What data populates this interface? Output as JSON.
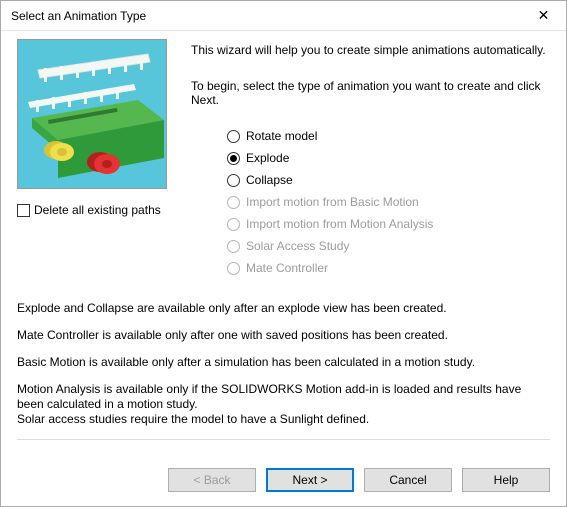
{
  "title": "Select an Animation Type",
  "intro1": "This wizard will help you to create simple animations automatically.",
  "intro2": "To begin, select the type of animation you want to create and click Next.",
  "delete_paths_label": "Delete all existing paths",
  "delete_paths_checked": false,
  "options": [
    {
      "label": "Rotate model",
      "enabled": true,
      "selected": false
    },
    {
      "label": "Explode",
      "enabled": true,
      "selected": true
    },
    {
      "label": "Collapse",
      "enabled": true,
      "selected": false
    },
    {
      "label": "Import motion from Basic Motion",
      "enabled": false,
      "selected": false
    },
    {
      "label": "Import motion from Motion Analysis",
      "enabled": false,
      "selected": false
    },
    {
      "label": "Solar Access Study",
      "enabled": false,
      "selected": false
    },
    {
      "label": "Mate Controller",
      "enabled": false,
      "selected": false
    }
  ],
  "notes": {
    "n1": "Explode and Collapse are available only after an explode view has been created.",
    "n2": "Mate Controller is available only after one with saved positions has been created.",
    "n3": "Basic Motion is available only after a simulation has been calculated in a motion study.",
    "n4": "Motion Analysis is available only if the SOLIDWORKS Motion add-in is loaded and results have been calculated in a motion study.",
    "n5": "Solar access studies require the model to have a Sunlight defined."
  },
  "buttons": {
    "back": "< Back",
    "next": "Next >",
    "cancel": "Cancel",
    "help": "Help"
  }
}
